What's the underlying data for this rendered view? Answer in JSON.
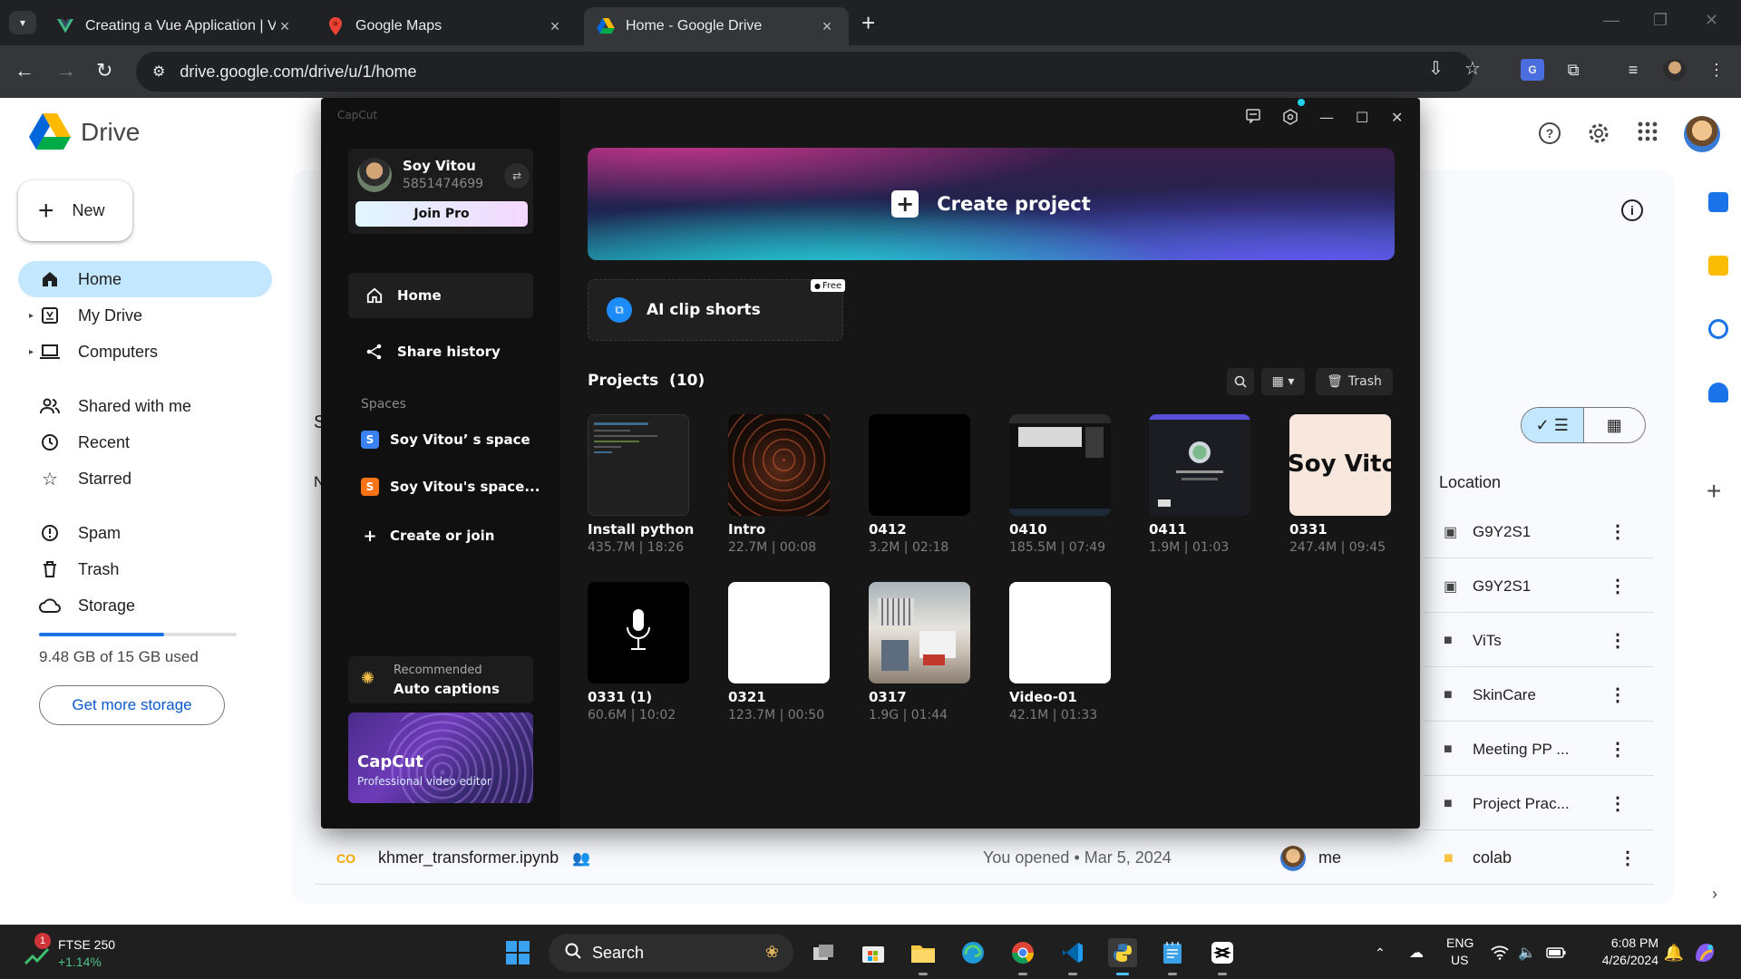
{
  "browser": {
    "tabs": [
      {
        "title": "Creating a Vue Application | Vue.js",
        "icon": "vue-icon",
        "active": false
      },
      {
        "title": "Google Maps",
        "icon": "maps-pin-icon",
        "active": false
      },
      {
        "title": "Home - Google Drive",
        "icon": "drive-icon",
        "active": true
      }
    ],
    "url": "drive.google.com/drive/u/1/home"
  },
  "drive": {
    "app_title": "Drive",
    "new_label": "New",
    "nav": [
      {
        "label": "Home",
        "icon": "home-icon",
        "selected": true
      },
      {
        "label": "My Drive",
        "icon": "my-drive-icon"
      },
      {
        "label": "Computers",
        "icon": "computers-icon"
      },
      {
        "label": "Shared with me",
        "icon": "shared-icon"
      },
      {
        "label": "Recent",
        "icon": "clock-icon"
      },
      {
        "label": "Starred",
        "icon": "star-icon"
      },
      {
        "label": "Spam",
        "icon": "spam-icon"
      },
      {
        "label": "Trash",
        "icon": "trash-icon"
      },
      {
        "label": "Storage",
        "icon": "cloud-icon"
      }
    ],
    "storage_used_fraction": 0.632,
    "storage_text": "9.48 GB of 15 GB used",
    "get_storage": "Get more storage",
    "location_header": "Location",
    "locations": [
      {
        "name": "G9Y2S1",
        "icon": "shared-folder-icon"
      },
      {
        "name": "G9Y2S1",
        "icon": "shared-folder-icon"
      },
      {
        "name": "ViTs",
        "icon": "folder-icon"
      },
      {
        "name": "SkinCare",
        "icon": "folder-icon"
      },
      {
        "name": "Meeting PP ...",
        "icon": "folder-icon"
      },
      {
        "name": "Project Prac...",
        "icon": "folder-icon"
      }
    ],
    "file_row": {
      "name": "khmer_transformer.ipynb",
      "opened": "You opened • Mar 5, 2024",
      "owner": "me",
      "location": "colab"
    },
    "stub_letter_s": "S",
    "stub_letter_n": "N"
  },
  "capcut": {
    "logo": "CapCut",
    "user": {
      "name": "Soy Vitou",
      "id": "5851474699",
      "join_pro": "Join Pro"
    },
    "nav": [
      {
        "label": "Home",
        "icon": "home-icon"
      },
      {
        "label": "Share history",
        "icon": "share-icon"
      }
    ],
    "spaces_label": "Spaces",
    "spaces": [
      {
        "label": "Soy Vitou’ s space",
        "letter": "S",
        "color": "#3b82f6"
      },
      {
        "label": "Soy Vitou's space...",
        "letter": "S",
        "color": "#f97316"
      }
    ],
    "create_or_join": "Create or join",
    "recommended": {
      "label": "Recommended",
      "title": "Auto captions"
    },
    "promo": {
      "title": "CapCut",
      "subtitle": "Professional video editor"
    },
    "create_project": "Create project",
    "ai_clip": "AI clip shorts",
    "free_badge": "Free",
    "projects_label": "Projects",
    "projects_count": "(10)",
    "trash_label": "Trash",
    "projects": [
      {
        "name": "Install python",
        "meta": "435.7M | 18:26",
        "thumb": "code"
      },
      {
        "name": "Intro",
        "meta": "22.7M | 00:08",
        "thumb": "lights"
      },
      {
        "name": "0412",
        "meta": "3.2M | 02:18",
        "thumb": "black"
      },
      {
        "name": "0410",
        "meta": "185.5M | 07:49",
        "thumb": "screen"
      },
      {
        "name": "0411",
        "meta": "1.9M | 01:03",
        "thumb": "app"
      },
      {
        "name": "0331",
        "meta": "247.4M | 09:45",
        "thumb": "text",
        "thumb_text": "Soy Vitou"
      },
      {
        "name": "0331 (1)",
        "meta": "60.6M | 10:02",
        "thumb": "mic"
      },
      {
        "name": "0321",
        "meta": "123.7M | 00:50",
        "thumb": "white"
      },
      {
        "name": "0317",
        "meta": "1.9G | 01:44",
        "thumb": "room"
      },
      {
        "name": "Video-01",
        "meta": "42.1M | 01:33",
        "thumb": "white"
      }
    ]
  },
  "taskbar": {
    "stock_name": "FTSE 250",
    "stock_change": "+1.14%",
    "stock_badge": "1",
    "search": "Search",
    "lang": "ENG",
    "region": "US",
    "time": "6:08 PM",
    "date": "4/26/2024"
  }
}
